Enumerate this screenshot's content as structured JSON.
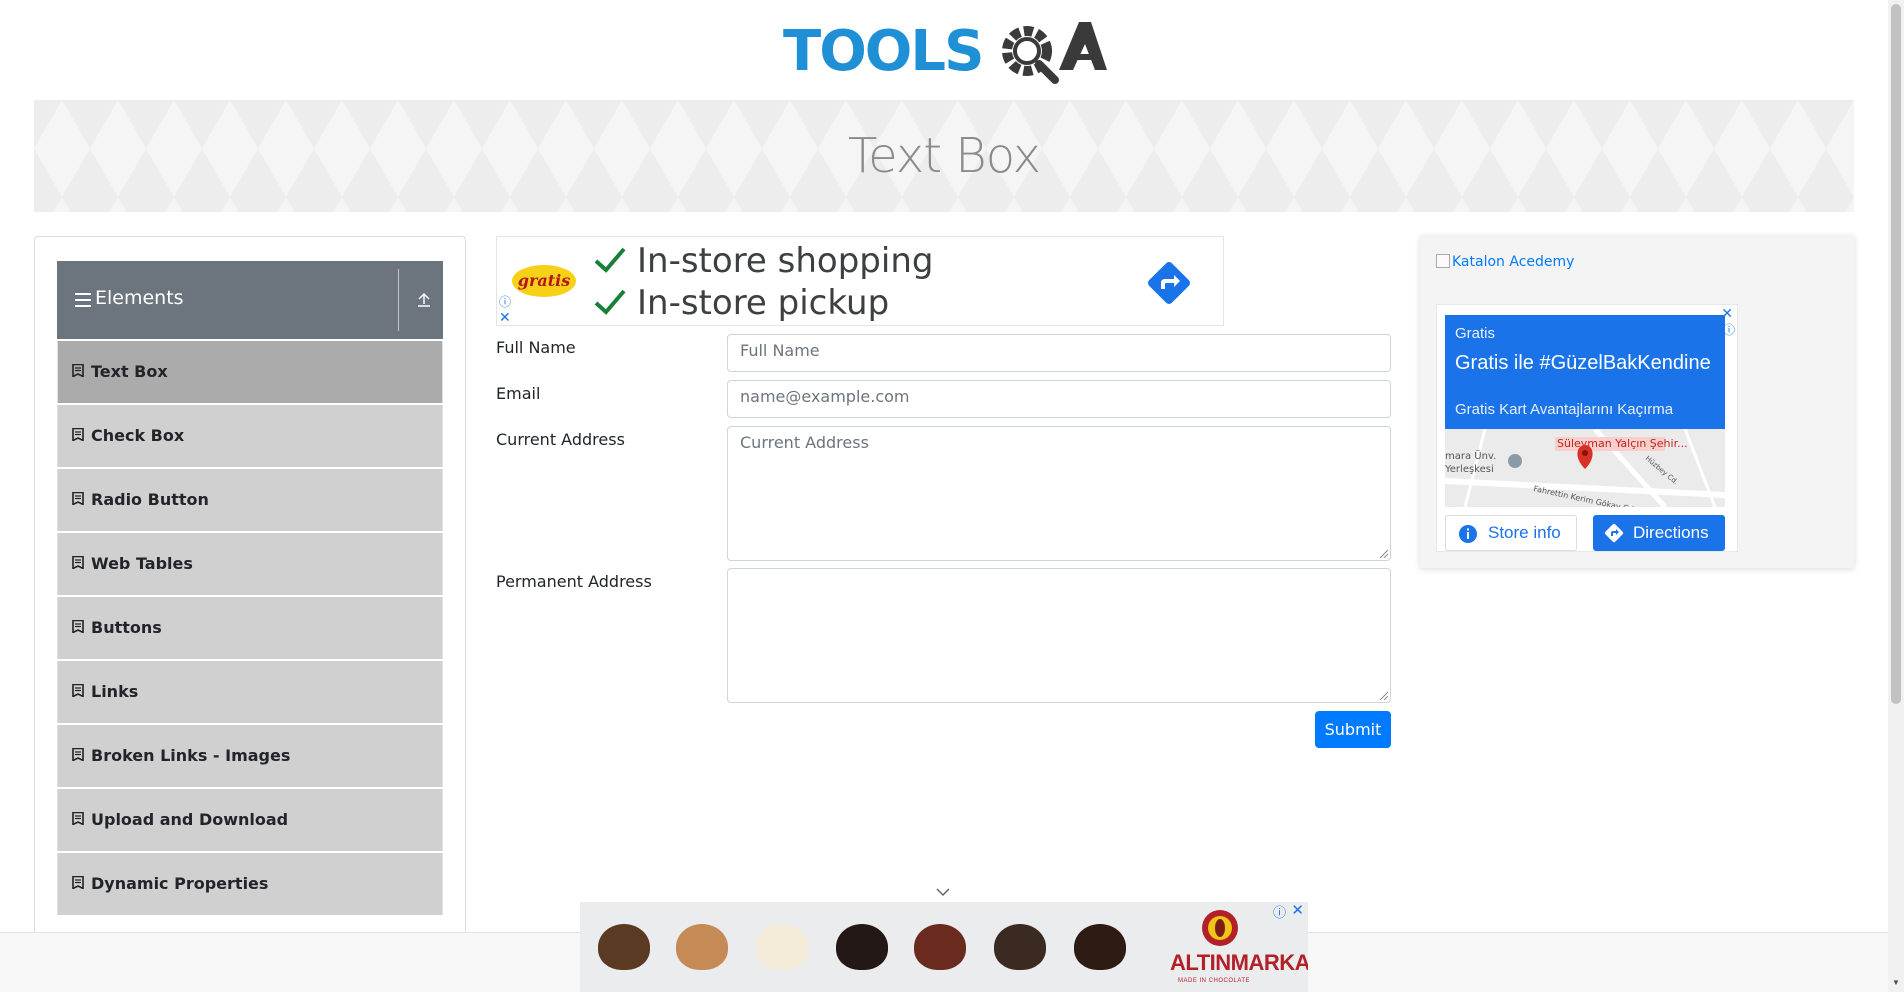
{
  "header": {
    "logo_text": "TOOLSQA"
  },
  "banner": {
    "title": "Text Box"
  },
  "sidebar": {
    "group_title": "Elements",
    "items": [
      {
        "label": "Text Box",
        "active": true
      },
      {
        "label": "Check Box",
        "active": false
      },
      {
        "label": "Radio Button",
        "active": false
      },
      {
        "label": "Web Tables",
        "active": false
      },
      {
        "label": "Buttons",
        "active": false
      },
      {
        "label": "Links",
        "active": false
      },
      {
        "label": "Broken Links - Images",
        "active": false
      },
      {
        "label": "Upload and Download",
        "active": false
      },
      {
        "label": "Dynamic Properties",
        "active": false
      }
    ]
  },
  "ad_top": {
    "brand": "gratis",
    "line1": "In-store shopping",
    "line2": "In-store pickup"
  },
  "form": {
    "full_name_label": "Full Name",
    "full_name_placeholder": "Full Name",
    "email_label": "Email",
    "email_placeholder": "name@example.com",
    "current_address_label": "Current Address",
    "current_address_placeholder": "Current Address",
    "permanent_address_label": "Permanent Address",
    "permanent_address_placeholder": "",
    "submit_label": "Submit"
  },
  "right_ad": {
    "katalon_alt": "Katalon Acedemy",
    "brand": "Gratis",
    "headline": "Gratis ile #GüzelBakKendine",
    "subline": "Gratis Kart Avantajlarını Kaçırma",
    "map_labels": [
      "Süleyman Yalçın Şehir...",
      "mara Ünv.",
      "Yerleşkesi",
      "Fahrettin Kerim Gökay Cd.",
      "Hüzbey Cd."
    ],
    "store_info_label": "Store info",
    "directions_label": "Directions"
  },
  "bottom_ad": {
    "brand": "ALTINMARKA",
    "tagline": "MADE IN CHOCOLATE"
  },
  "colors": {
    "primary": "#007bff",
    "sidebar_header": "#6c757d",
    "sidebar_item": "#d0d0d0",
    "sidebar_active": "#ababab",
    "ad_blue": "#1a73e8",
    "logo_blue": "#1f8fd6",
    "logo_dark": "#3a3a3a"
  }
}
